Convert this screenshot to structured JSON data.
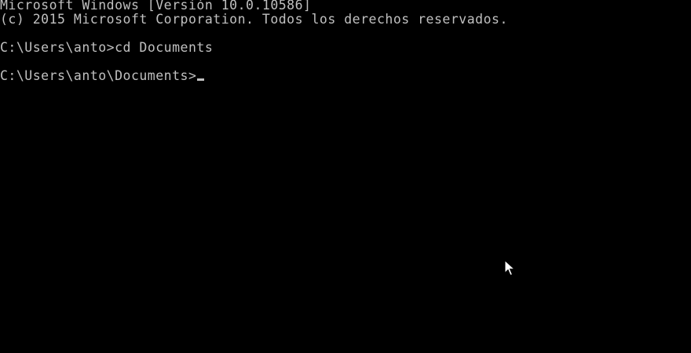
{
  "console": {
    "header_line_1": "Microsoft Windows [Versión 10.0.10586]",
    "header_line_2": "(c) 2015 Microsoft Corporation. Todos los derechos reservados.",
    "history_prompt": "C:\\Users\\anto>",
    "history_command": "cd Documents",
    "current_prompt": "C:\\Users\\anto\\Documents>",
    "current_input": ""
  },
  "colors": {
    "background": "#000000",
    "text": "#c0c0c0"
  },
  "icons": {
    "mouse_pointer": "arrow-cursor-icon"
  }
}
